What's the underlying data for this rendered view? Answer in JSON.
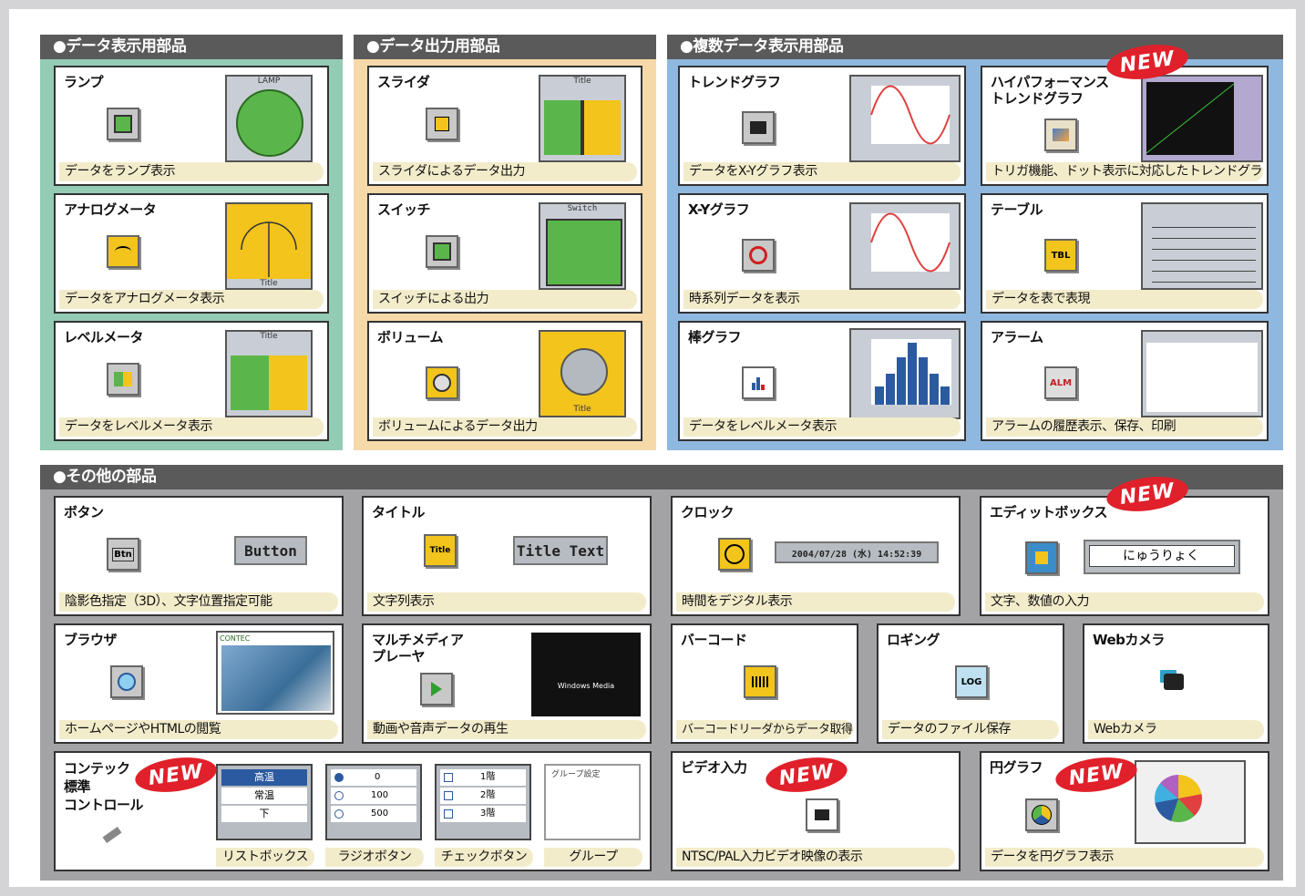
{
  "sections": {
    "display": "●データ表示用部品",
    "output": "●データ出力用部品",
    "multi": "●複数データ表示用部品",
    "other": "●その他の部品"
  },
  "new_badge": "NEW",
  "cards": {
    "lamp": {
      "title": "ランプ",
      "desc": "データをランプ表示",
      "preview_label": "LAMP"
    },
    "analog": {
      "title": "アナログメータ",
      "desc": "データをアナログメータ表示",
      "preview_label": "Title"
    },
    "level": {
      "title": "レベルメータ",
      "desc": "データをレベルメータ表示",
      "preview_label": "Title"
    },
    "slider": {
      "title": "スライダ",
      "desc": "スライダによるデータ出力",
      "preview_label": "Title"
    },
    "switch": {
      "title": "スイッチ",
      "desc": "スイッチによる出力",
      "preview_label": "Switch"
    },
    "volume": {
      "title": "ボリューム",
      "desc": "ボリュームによるデータ出力",
      "preview_label": "Title"
    },
    "trend": {
      "title": "トレンドグラフ",
      "desc": "データをX-Yグラフ表示"
    },
    "hptrend": {
      "title1": "ハイパフォーマンス",
      "title2": "トレンドグラフ",
      "desc": "トリガ機能、ドット表示に対応したトレンドグラフ"
    },
    "xy": {
      "title": "X-Yグラフ",
      "desc": "時系列データを表示"
    },
    "table": {
      "title": "テーブル",
      "desc": "データを表で表現",
      "icon_text": "TBL"
    },
    "bar": {
      "title": "棒グラフ",
      "desc": "データをレベルメータ表示"
    },
    "alarm": {
      "title": "アラーム",
      "desc": "アラームの履歴表示、保存、印刷",
      "icon_text": "ALM"
    },
    "button": {
      "title": "ボタン",
      "desc": "陰影色指定（3D）、文字位置指定可能",
      "preview": "Button",
      "icon_text": "Btn"
    },
    "titlecomp": {
      "title": "タイトル",
      "desc": "文字列表示",
      "preview": "Title Text",
      "icon_text": "Title"
    },
    "clock": {
      "title": "クロック",
      "desc": "時間をデジタル表示",
      "preview": "2004/07/28 (水)  14:52:39"
    },
    "editbox": {
      "title": "エディットボックス",
      "desc": "文字、数値の入力",
      "preview": "にゅうりょく"
    },
    "browser": {
      "title": "ブラウザ",
      "desc": "ホームページやHTMLの閲覧",
      "preview_label": "CONTEC"
    },
    "multimedia": {
      "title1": "マルチメディア",
      "title2": "プレーヤ",
      "desc": "動画や音声データの再生",
      "preview_label": "Windows Media"
    },
    "barcode": {
      "title": "バーコード",
      "desc": "バーコードリーダからデータ取得"
    },
    "logging": {
      "title": "ロギング",
      "desc": "データのファイル保存",
      "icon_text": "LOG"
    },
    "webcam": {
      "title": "Webカメラ",
      "desc": "Webカメラ"
    },
    "contec": {
      "title1": "コンテック",
      "title2": "標準",
      "title3": "コントロール"
    },
    "listbox": {
      "label": "リストボックス",
      "items": [
        "高温",
        "常温",
        "下"
      ]
    },
    "radio": {
      "label": "ラジオボタン",
      "items": [
        "0",
        "100",
        "500"
      ]
    },
    "checkbox": {
      "label": "チェックボタン",
      "items": [
        "1階",
        "2階",
        "3階"
      ]
    },
    "group": {
      "label": "グループ",
      "caption": "グループ設定"
    },
    "video": {
      "title": "ビデオ入力",
      "desc": "NTSC/PAL入力ビデオ映像の表示"
    },
    "pie": {
      "title": "円グラフ",
      "desc": "データを円グラフ表示"
    }
  },
  "colors": {
    "display": "#93cbb4",
    "output": "#f6d9a8",
    "multi": "#8fb8e0",
    "other": "#a3a3a6",
    "header": "#5a5a5a",
    "new": "#e0202a"
  }
}
